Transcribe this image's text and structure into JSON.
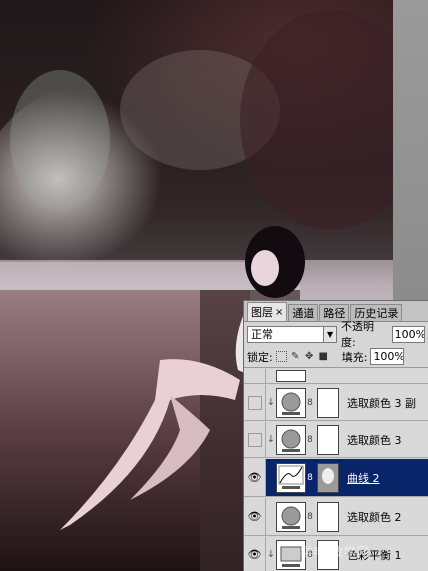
{
  "panel": {
    "tabs": [
      {
        "label": "图层",
        "close": "×"
      },
      {
        "label": "通道"
      },
      {
        "label": "路径"
      },
      {
        "label": "历史记录"
      }
    ],
    "blend_mode": "正常",
    "opacity_label": "不透明度:",
    "opacity_value": "100%",
    "lock_label": "锁定:",
    "fill_label": "填充:",
    "fill_value": "100%",
    "layers": [
      {
        "name": "",
        "visible": false,
        "selected": false
      },
      {
        "name": "选取颜色 3 副",
        "visible": false,
        "selected": false
      },
      {
        "name": "选取颜色 3",
        "visible": false,
        "selected": false
      },
      {
        "name": "曲线 2",
        "visible": true,
        "selected": true
      },
      {
        "name": "选取颜色 2",
        "visible": true,
        "selected": false
      },
      {
        "name": "色彩平衡 1",
        "visible": true,
        "selected": false
      }
    ]
  },
  "watermark": "学电 教学网",
  "colors": {
    "selected_row": "#0a246a",
    "panel_bg": "#d6d6d6"
  }
}
